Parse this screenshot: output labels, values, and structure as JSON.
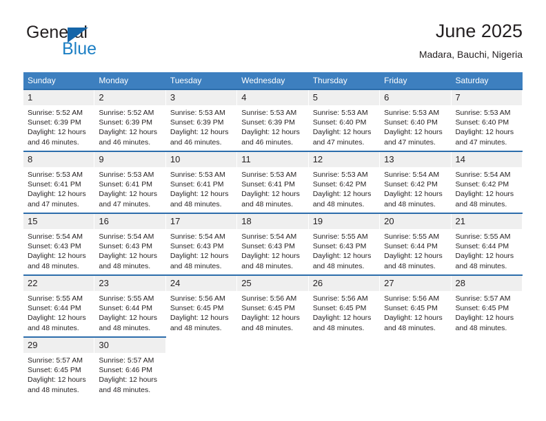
{
  "brand": {
    "name_top": "General",
    "name_bottom": "Blue",
    "triangle_color": "#1565a8",
    "blue_color": "#1c7fc4"
  },
  "header": {
    "title": "June 2025",
    "location": "Madara, Bauchi, Nigeria"
  },
  "theme": {
    "header_bg": "#3d7fbf",
    "row_border": "#2b6cab",
    "daynum_bg": "#efefef",
    "text": "#231f20"
  },
  "weekdays": [
    "Sunday",
    "Monday",
    "Tuesday",
    "Wednesday",
    "Thursday",
    "Friday",
    "Saturday"
  ],
  "labels": {
    "sunrise_prefix": "Sunrise:",
    "sunset_prefix": "Sunset:",
    "daylight_prefix": "Daylight:"
  },
  "weeks": [
    [
      {
        "day": "1",
        "sunrise": "Sunrise: 5:52 AM",
        "sunset": "Sunset: 6:39 PM",
        "daylight": "Daylight: 12 hours and 46 minutes."
      },
      {
        "day": "2",
        "sunrise": "Sunrise: 5:52 AM",
        "sunset": "Sunset: 6:39 PM",
        "daylight": "Daylight: 12 hours and 46 minutes."
      },
      {
        "day": "3",
        "sunrise": "Sunrise: 5:53 AM",
        "sunset": "Sunset: 6:39 PM",
        "daylight": "Daylight: 12 hours and 46 minutes."
      },
      {
        "day": "4",
        "sunrise": "Sunrise: 5:53 AM",
        "sunset": "Sunset: 6:39 PM",
        "daylight": "Daylight: 12 hours and 46 minutes."
      },
      {
        "day": "5",
        "sunrise": "Sunrise: 5:53 AM",
        "sunset": "Sunset: 6:40 PM",
        "daylight": "Daylight: 12 hours and 47 minutes."
      },
      {
        "day": "6",
        "sunrise": "Sunrise: 5:53 AM",
        "sunset": "Sunset: 6:40 PM",
        "daylight": "Daylight: 12 hours and 47 minutes."
      },
      {
        "day": "7",
        "sunrise": "Sunrise: 5:53 AM",
        "sunset": "Sunset: 6:40 PM",
        "daylight": "Daylight: 12 hours and 47 minutes."
      }
    ],
    [
      {
        "day": "8",
        "sunrise": "Sunrise: 5:53 AM",
        "sunset": "Sunset: 6:41 PM",
        "daylight": "Daylight: 12 hours and 47 minutes."
      },
      {
        "day": "9",
        "sunrise": "Sunrise: 5:53 AM",
        "sunset": "Sunset: 6:41 PM",
        "daylight": "Daylight: 12 hours and 47 minutes."
      },
      {
        "day": "10",
        "sunrise": "Sunrise: 5:53 AM",
        "sunset": "Sunset: 6:41 PM",
        "daylight": "Daylight: 12 hours and 48 minutes."
      },
      {
        "day": "11",
        "sunrise": "Sunrise: 5:53 AM",
        "sunset": "Sunset: 6:41 PM",
        "daylight": "Daylight: 12 hours and 48 minutes."
      },
      {
        "day": "12",
        "sunrise": "Sunrise: 5:53 AM",
        "sunset": "Sunset: 6:42 PM",
        "daylight": "Daylight: 12 hours and 48 minutes."
      },
      {
        "day": "13",
        "sunrise": "Sunrise: 5:54 AM",
        "sunset": "Sunset: 6:42 PM",
        "daylight": "Daylight: 12 hours and 48 minutes."
      },
      {
        "day": "14",
        "sunrise": "Sunrise: 5:54 AM",
        "sunset": "Sunset: 6:42 PM",
        "daylight": "Daylight: 12 hours and 48 minutes."
      }
    ],
    [
      {
        "day": "15",
        "sunrise": "Sunrise: 5:54 AM",
        "sunset": "Sunset: 6:43 PM",
        "daylight": "Daylight: 12 hours and 48 minutes."
      },
      {
        "day": "16",
        "sunrise": "Sunrise: 5:54 AM",
        "sunset": "Sunset: 6:43 PM",
        "daylight": "Daylight: 12 hours and 48 minutes."
      },
      {
        "day": "17",
        "sunrise": "Sunrise: 5:54 AM",
        "sunset": "Sunset: 6:43 PM",
        "daylight": "Daylight: 12 hours and 48 minutes."
      },
      {
        "day": "18",
        "sunrise": "Sunrise: 5:54 AM",
        "sunset": "Sunset: 6:43 PM",
        "daylight": "Daylight: 12 hours and 48 minutes."
      },
      {
        "day": "19",
        "sunrise": "Sunrise: 5:55 AM",
        "sunset": "Sunset: 6:43 PM",
        "daylight": "Daylight: 12 hours and 48 minutes."
      },
      {
        "day": "20",
        "sunrise": "Sunrise: 5:55 AM",
        "sunset": "Sunset: 6:44 PM",
        "daylight": "Daylight: 12 hours and 48 minutes."
      },
      {
        "day": "21",
        "sunrise": "Sunrise: 5:55 AM",
        "sunset": "Sunset: 6:44 PM",
        "daylight": "Daylight: 12 hours and 48 minutes."
      }
    ],
    [
      {
        "day": "22",
        "sunrise": "Sunrise: 5:55 AM",
        "sunset": "Sunset: 6:44 PM",
        "daylight": "Daylight: 12 hours and 48 minutes."
      },
      {
        "day": "23",
        "sunrise": "Sunrise: 5:55 AM",
        "sunset": "Sunset: 6:44 PM",
        "daylight": "Daylight: 12 hours and 48 minutes."
      },
      {
        "day": "24",
        "sunrise": "Sunrise: 5:56 AM",
        "sunset": "Sunset: 6:45 PM",
        "daylight": "Daylight: 12 hours and 48 minutes."
      },
      {
        "day": "25",
        "sunrise": "Sunrise: 5:56 AM",
        "sunset": "Sunset: 6:45 PM",
        "daylight": "Daylight: 12 hours and 48 minutes."
      },
      {
        "day": "26",
        "sunrise": "Sunrise: 5:56 AM",
        "sunset": "Sunset: 6:45 PM",
        "daylight": "Daylight: 12 hours and 48 minutes."
      },
      {
        "day": "27",
        "sunrise": "Sunrise: 5:56 AM",
        "sunset": "Sunset: 6:45 PM",
        "daylight": "Daylight: 12 hours and 48 minutes."
      },
      {
        "day": "28",
        "sunrise": "Sunrise: 5:57 AM",
        "sunset": "Sunset: 6:45 PM",
        "daylight": "Daylight: 12 hours and 48 minutes."
      }
    ],
    [
      {
        "day": "29",
        "sunrise": "Sunrise: 5:57 AM",
        "sunset": "Sunset: 6:45 PM",
        "daylight": "Daylight: 12 hours and 48 minutes."
      },
      {
        "day": "30",
        "sunrise": "Sunrise: 5:57 AM",
        "sunset": "Sunset: 6:46 PM",
        "daylight": "Daylight: 12 hours and 48 minutes."
      },
      null,
      null,
      null,
      null,
      null
    ]
  ]
}
